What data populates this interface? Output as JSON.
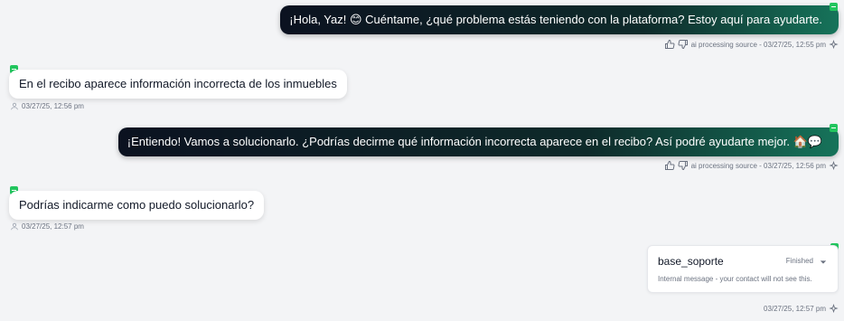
{
  "messages": [
    {
      "text": "¡Hola, Yaz! 😊 Cuéntame, ¿qué problema estás teniendo con la plataforma? Estoy aquí para ayudarte.",
      "meta": "ai processing source - 03/27/25, 12:55 pm"
    },
    {
      "text": "En el recibo aparece información incorrecta de los inmuebles",
      "meta": "03/27/25, 12:56 pm"
    },
    {
      "text": "¡Entiendo! Vamos a solucionarlo. ¿Podrías decirme qué información incorrecta aparece en el recibo? Así podré ayudarte mejor. 🏠💬",
      "meta": "ai processing source - 03/27/25, 12:56 pm"
    },
    {
      "text": "Podrías indicarme como puedo solucionarlo?",
      "meta": "03/27/25, 12:57 pm"
    }
  ],
  "internal_card": {
    "title": "base_soporte",
    "status": "Finished",
    "note": "Internal message - your contact will not see this.",
    "meta": "03/27/25, 12:57 pm"
  },
  "colors": {
    "accent_green": "#22c55e",
    "outgoing_bubble_dark": "#0b1220",
    "outgoing_bubble_teal": "#16735a",
    "page_background": "#f3f4f6"
  },
  "icons": {
    "thumbs_up": "thumbs-up-icon",
    "thumbs_down": "thumbs-down-icon",
    "ai_sparkle": "sparkle-icon",
    "user": "user-icon",
    "chevron": "chevron-down-icon"
  }
}
